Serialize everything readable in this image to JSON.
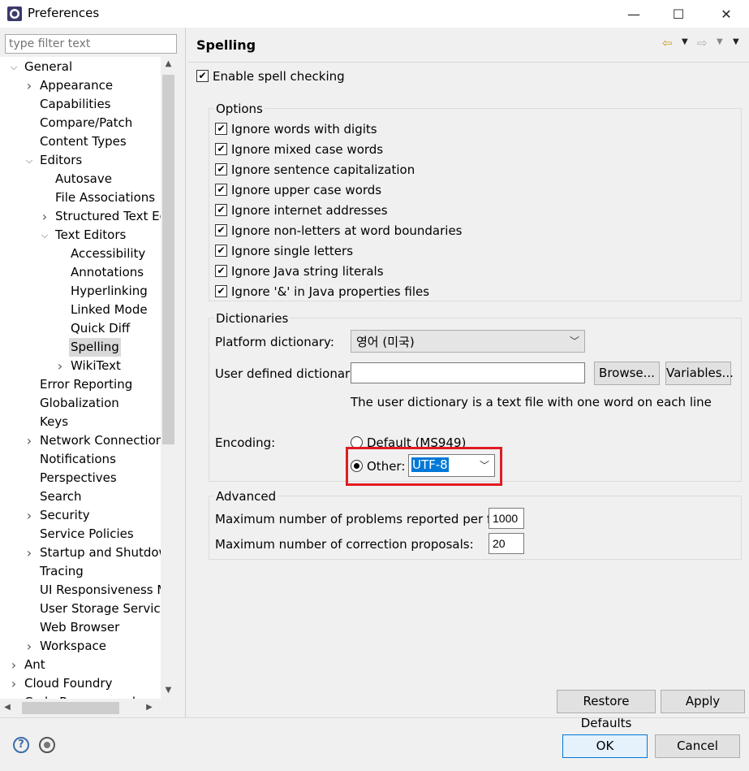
{
  "window": {
    "title": "Preferences",
    "minimize": "—",
    "maximize": "☐",
    "close": "✕"
  },
  "left": {
    "filter_placeholder": "type filter text",
    "tree": [
      {
        "label": "General",
        "arrow": "open"
      },
      {
        "label": "Appearance",
        "arrow": "closed"
      },
      {
        "label": "Capabilities",
        "arrow": ""
      },
      {
        "label": "Compare/Patch",
        "arrow": ""
      },
      {
        "label": "Content Types",
        "arrow": ""
      },
      {
        "label": "Editors",
        "arrow": "open"
      },
      {
        "label": "Autosave",
        "arrow": ""
      },
      {
        "label": "File Associations",
        "arrow": ""
      },
      {
        "label": "Structured Text Edi",
        "arrow": "closed"
      },
      {
        "label": "Text Editors",
        "arrow": "open"
      },
      {
        "label": "Accessibility",
        "arrow": ""
      },
      {
        "label": "Annotations",
        "arrow": ""
      },
      {
        "label": "Hyperlinking",
        "arrow": ""
      },
      {
        "label": "Linked Mode",
        "arrow": ""
      },
      {
        "label": "Quick Diff",
        "arrow": ""
      },
      {
        "label": "Spelling",
        "arrow": "",
        "selected": true
      },
      {
        "label": "WikiText",
        "arrow": "closed"
      },
      {
        "label": "Error Reporting",
        "arrow": ""
      },
      {
        "label": "Globalization",
        "arrow": ""
      },
      {
        "label": "Keys",
        "arrow": ""
      },
      {
        "label": "Network Connections",
        "arrow": "closed"
      },
      {
        "label": "Notifications",
        "arrow": ""
      },
      {
        "label": "Perspectives",
        "arrow": ""
      },
      {
        "label": "Search",
        "arrow": ""
      },
      {
        "label": "Security",
        "arrow": "closed"
      },
      {
        "label": "Service Policies",
        "arrow": ""
      },
      {
        "label": "Startup and Shutdowr",
        "arrow": "closed"
      },
      {
        "label": "Tracing",
        "arrow": ""
      },
      {
        "label": "UI Responsiveness Mc",
        "arrow": ""
      },
      {
        "label": "User Storage Service",
        "arrow": ""
      },
      {
        "label": "Web Browser",
        "arrow": ""
      },
      {
        "label": "Workspace",
        "arrow": "closed"
      },
      {
        "label": "Ant",
        "arrow": "closed"
      },
      {
        "label": "Cloud Foundry",
        "arrow": "closed"
      },
      {
        "label": "Code Recommenders",
        "arrow": "closed"
      }
    ]
  },
  "page": {
    "title": "Spelling",
    "enable_spell_checking": "Enable spell checking",
    "options": {
      "title": "Options",
      "items": [
        "Ignore words with digits",
        "Ignore mixed case words",
        "Ignore sentence capitalization",
        "Ignore upper case words",
        "Ignore internet addresses",
        "Ignore non-letters at word boundaries",
        "Ignore single letters",
        "Ignore Java string literals",
        "Ignore '&' in Java properties files"
      ]
    },
    "dictionaries": {
      "title": "Dictionaries",
      "platform_label": "Platform dictionary:",
      "platform_value": "영어 (미국)",
      "user_label": "User defined dictionary:",
      "user_value": "",
      "browse": "Browse...",
      "variables": "Variables...",
      "hint": "The user dictionary is a text file with one word on each line",
      "encoding_label": "Encoding:",
      "default_option": "Default (MS949)",
      "other_option": "Other:",
      "other_value": "UTF-8"
    },
    "advanced": {
      "title": "Advanced",
      "max_problems_label": "Maximum number of problems reported per file:",
      "max_problems_value": "1000",
      "max_proposals_label": "Maximum number of correction proposals:",
      "max_proposals_value": "20"
    },
    "restore_defaults": "Restore Defaults",
    "apply": "Apply"
  },
  "footer": {
    "help_glyph": "?",
    "ok": "OK",
    "cancel": "Cancel"
  },
  "colors": {
    "highlight_border": "#e01b22",
    "selection_blue": "#0078d7"
  }
}
